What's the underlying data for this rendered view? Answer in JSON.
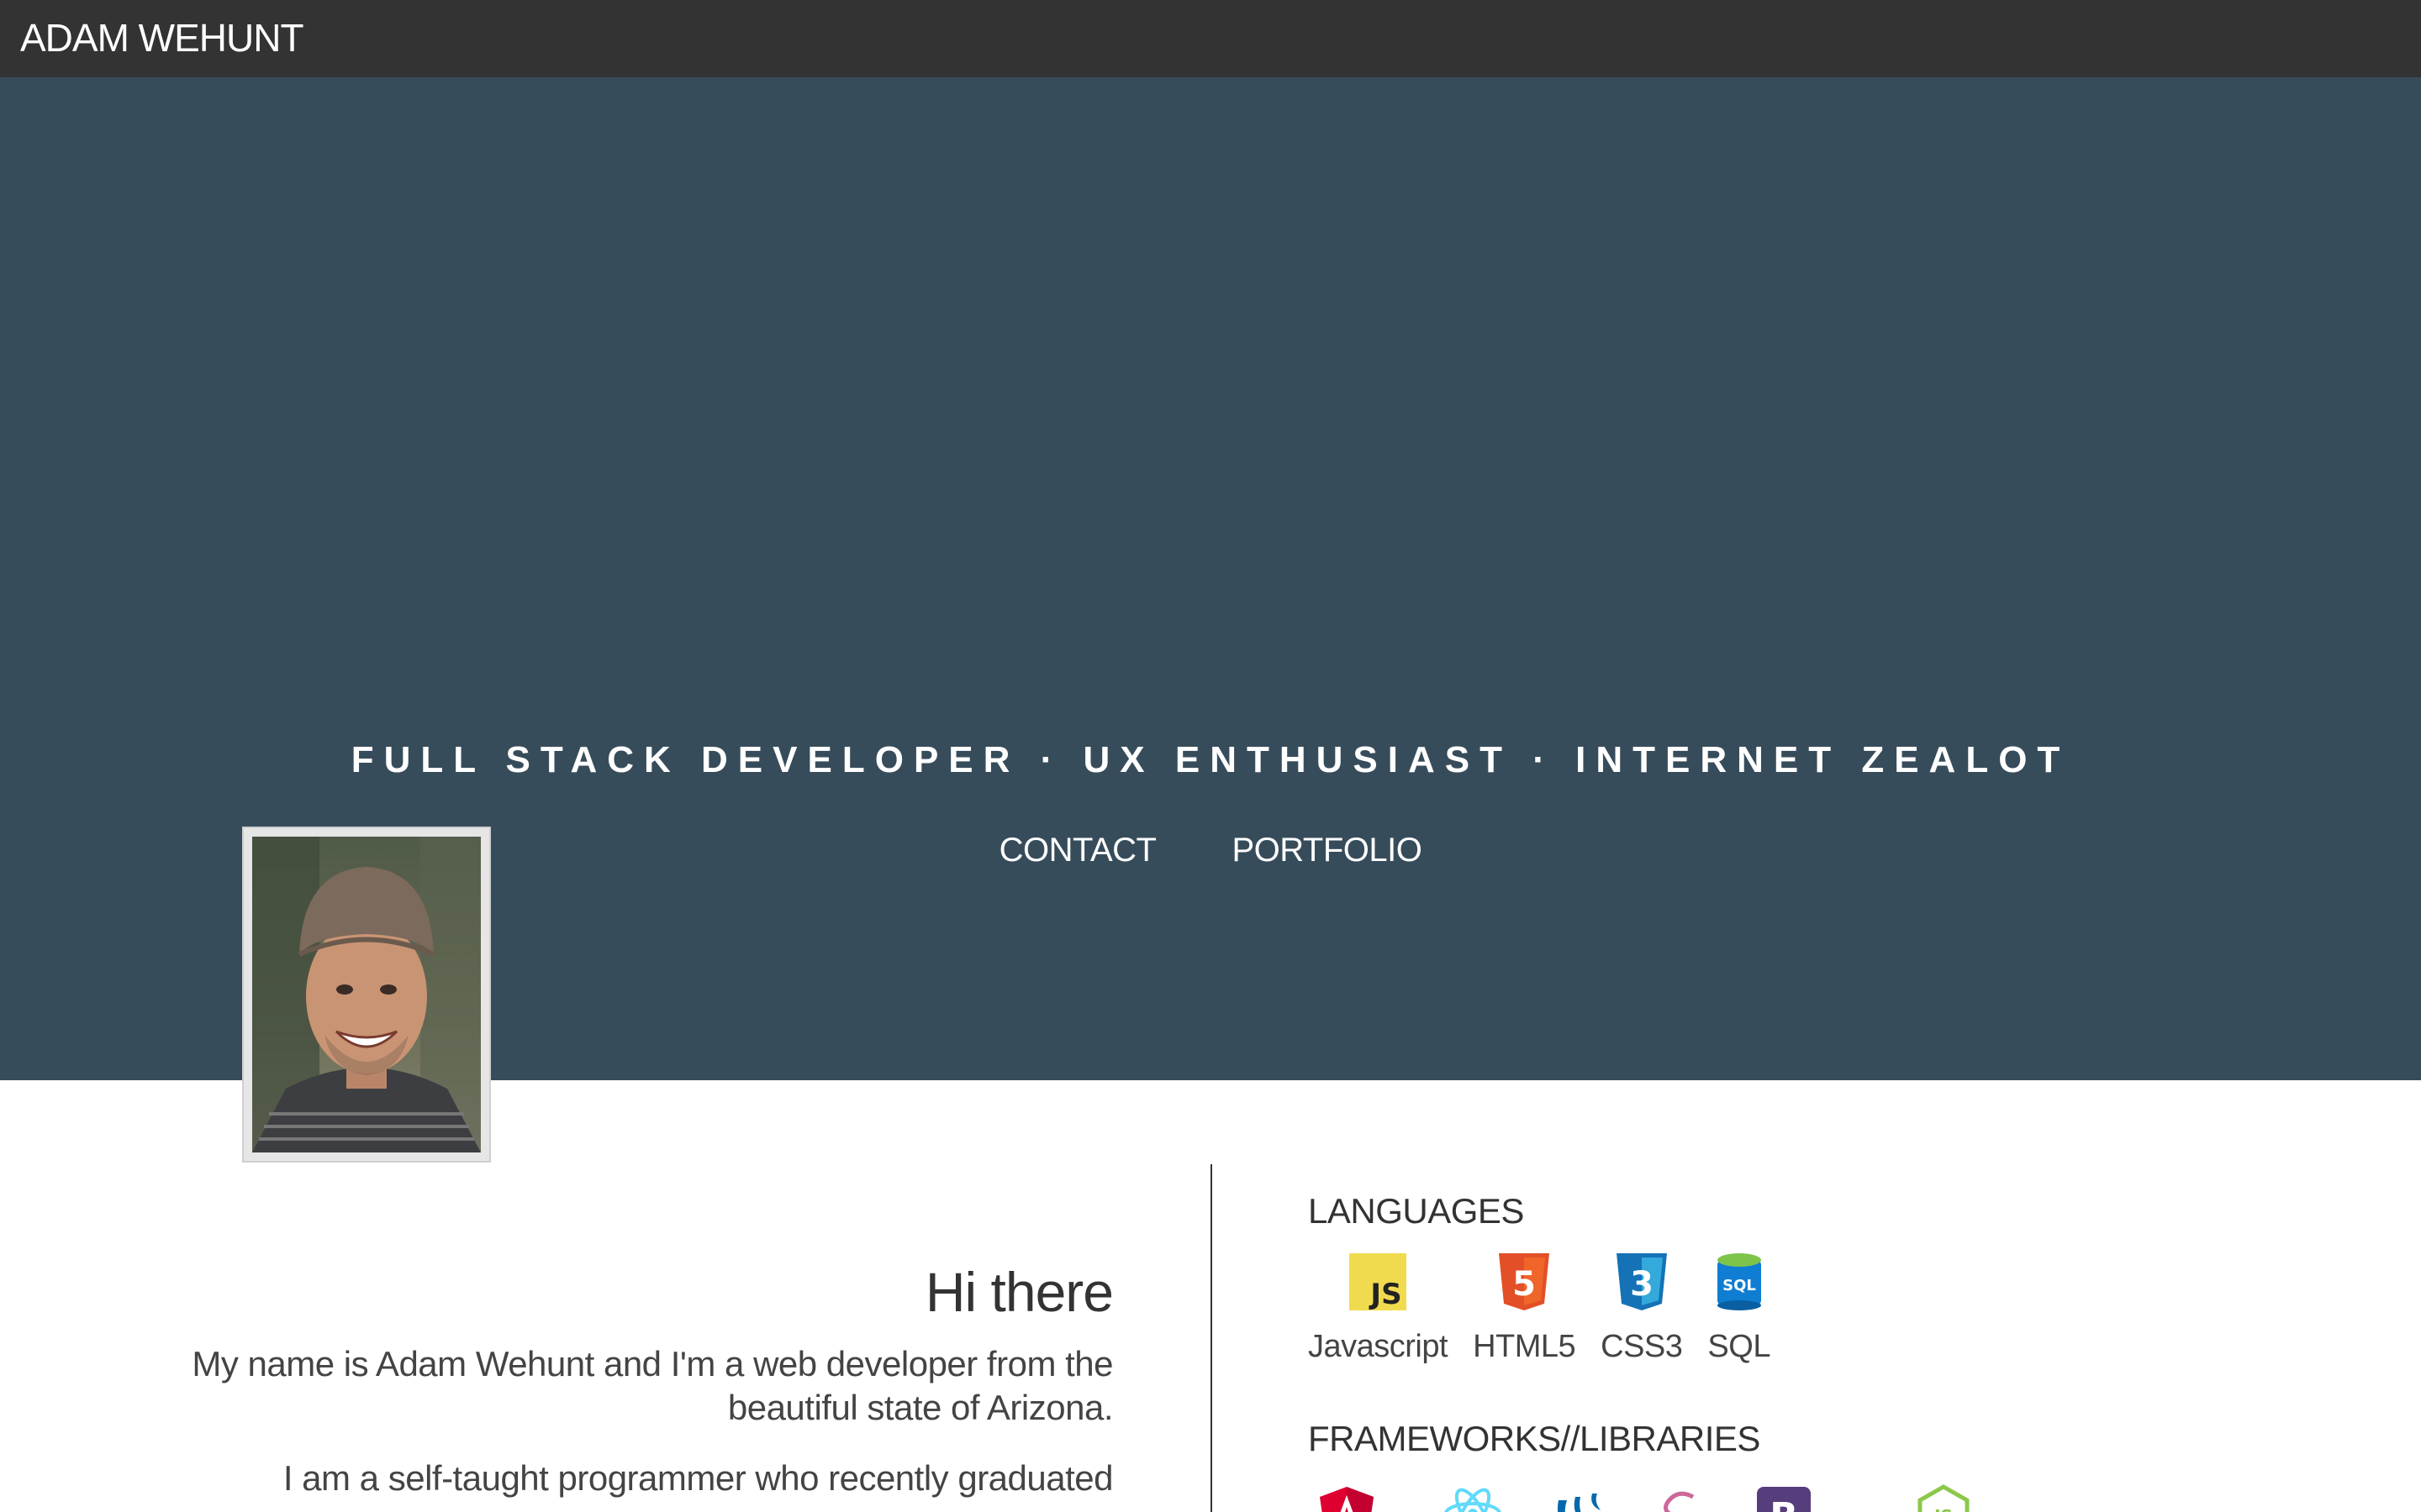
{
  "header": {
    "brand": "ADAM WEHUNT"
  },
  "hero": {
    "tagline": "FULL STACK DEVELOPER · UX ENTHUSIAST · INTERNET ZEALOT",
    "nav": [
      {
        "label": "CONTACT"
      },
      {
        "label": "PORTFOLIO"
      }
    ]
  },
  "intro": {
    "heading": "Hi there",
    "paragraph1": "My name is Adam Wehunt and I'm a web developer from the beautiful state of Arizona.",
    "paragraph2": "I am a self-taught programmer who recently graduated"
  },
  "skills": {
    "languages_title": "LANGUAGES",
    "languages": [
      {
        "label": "Javascript",
        "icon": "javascript-icon"
      },
      {
        "label": "HTML5",
        "icon": "html5-icon"
      },
      {
        "label": "CSS3",
        "icon": "css3-icon"
      },
      {
        "label": "SQL",
        "icon": "sql-icon"
      }
    ],
    "frameworks_title": "FRAMEWORKS//LIBRARIES",
    "frameworks_icons": [
      "angular-icon",
      "react-icon",
      "jquery-icon",
      "sass-icon",
      "bootstrap-icon",
      "nodejs-icon"
    ]
  },
  "colors": {
    "topbar": "#333333",
    "hero": "#374c5b",
    "text": "#333333",
    "js": "#f0db4f",
    "html5": "#e34f26",
    "css3": "#1572b6",
    "sql": "#0f7dd2"
  }
}
